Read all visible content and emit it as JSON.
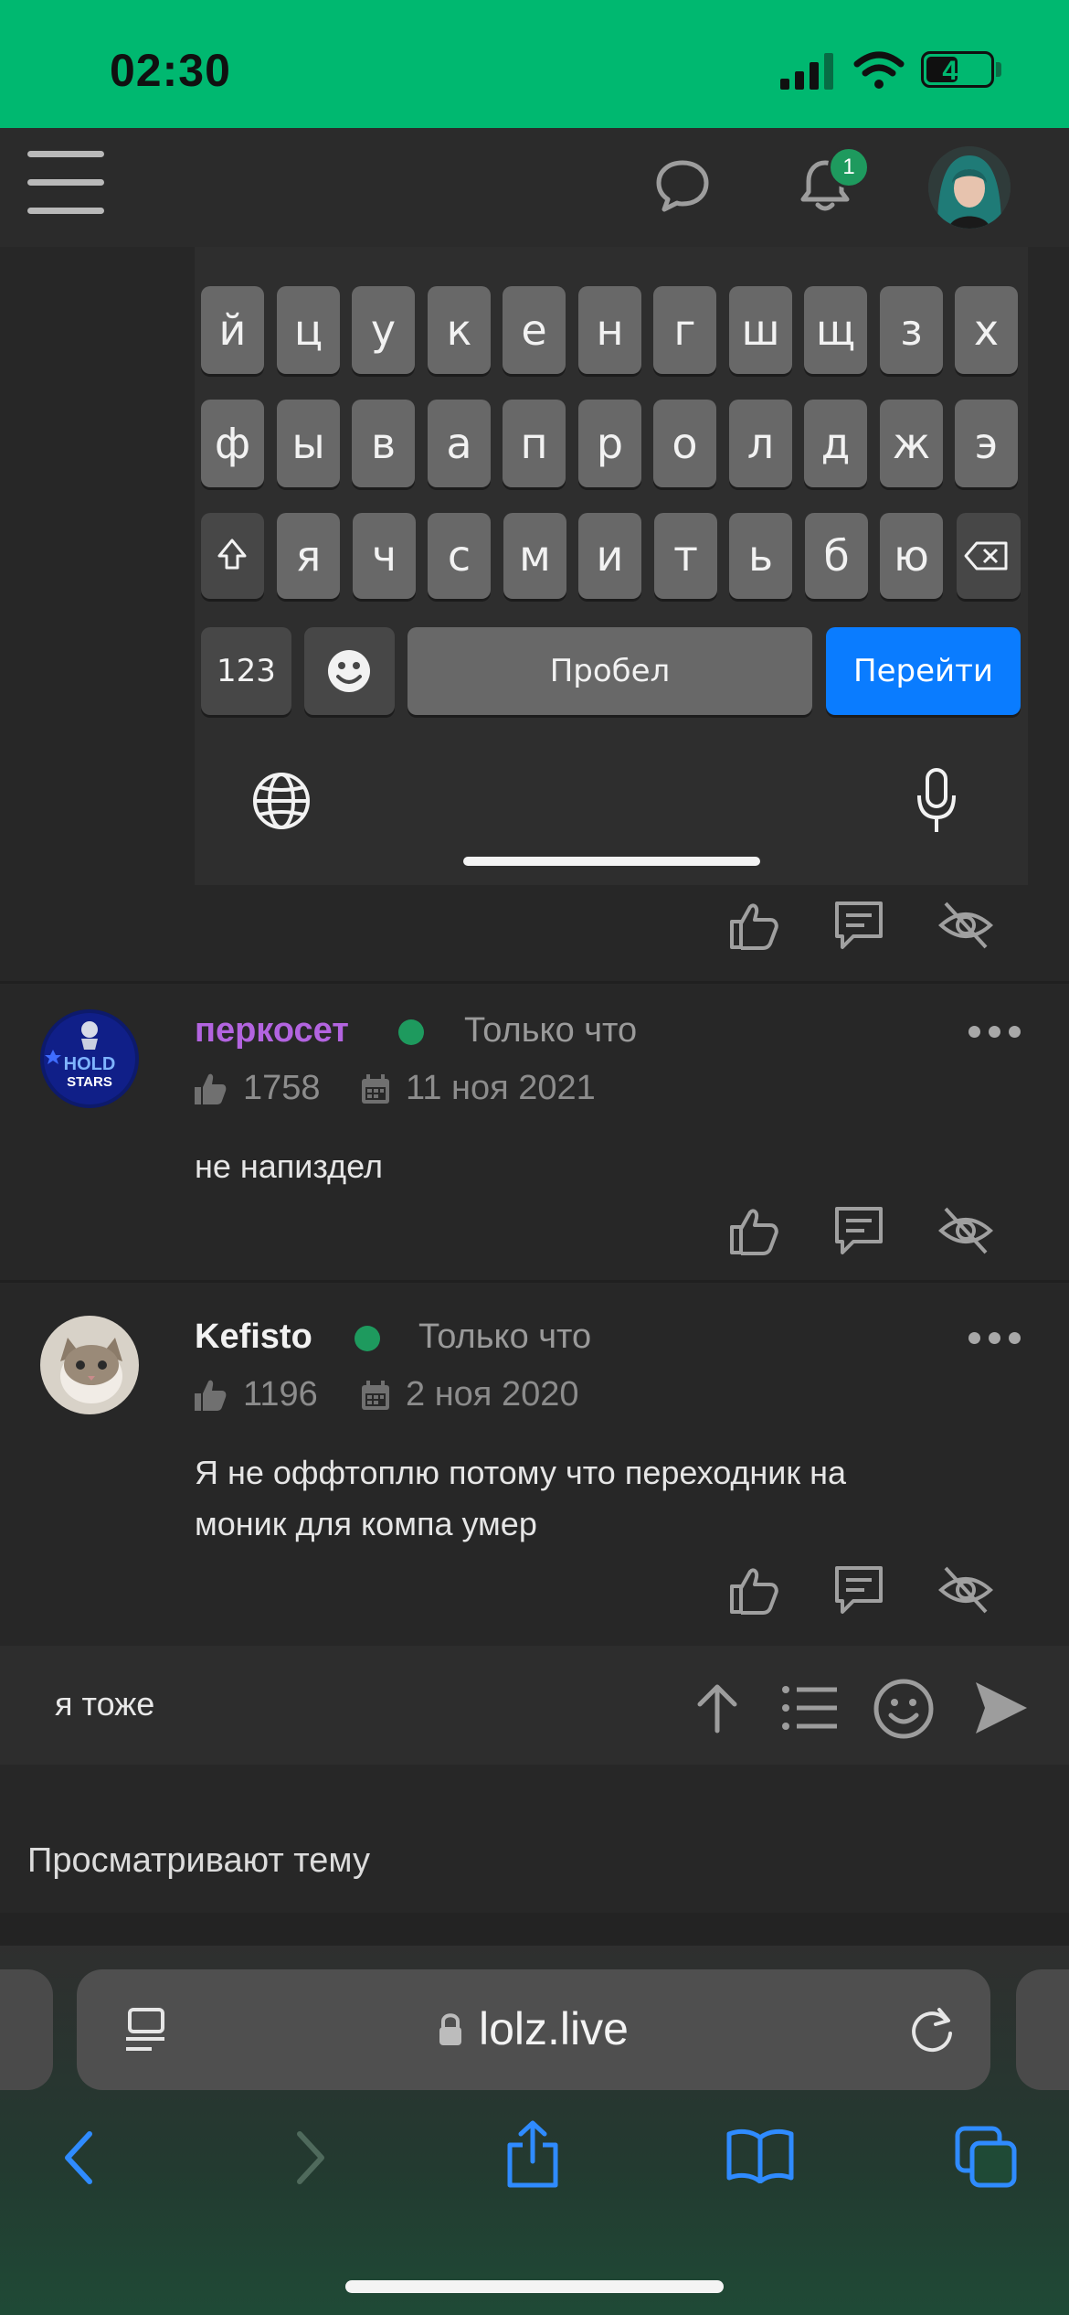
{
  "status_bar": {
    "time": "02:30",
    "battery": "47"
  },
  "header": {
    "notification_count": "1"
  },
  "keyboard": {
    "row1": [
      "й",
      "ц",
      "у",
      "к",
      "е",
      "н",
      "г",
      "ш",
      "щ",
      "з",
      "х"
    ],
    "row2": [
      "ф",
      "ы",
      "в",
      "а",
      "п",
      "р",
      "о",
      "л",
      "д",
      "ж",
      "э"
    ],
    "row3": [
      "я",
      "ч",
      "с",
      "м",
      "и",
      "т",
      "ь",
      "б",
      "ю"
    ],
    "numbers_label": "123",
    "space_label": "Пробел",
    "go_label": "Перейти"
  },
  "posts": [
    {
      "username": "перкосет",
      "username_color": "#b364e0",
      "time": "Только что",
      "likes": "1758",
      "registered": "11 ноя 2021",
      "avatar_text": [
        "HOLD",
        "STARS"
      ],
      "text": "не напиздел"
    },
    {
      "username": "Kefisto",
      "username_color": "#f2f2f2",
      "time": "Только что",
      "likes": "1196",
      "registered": "2 ноя 2020",
      "text_line1": "Я не оффтоплю потому что переходник на",
      "text_line2": "моник для компа умер"
    }
  ],
  "compose": {
    "value": "я тоже"
  },
  "viewers_label": "Просматривают тему",
  "browser": {
    "url": "lolz.live"
  },
  "colors": {
    "accent_green": "#00b870",
    "online": "#1e9a5e",
    "keyboard_go": "#0a7cff"
  }
}
